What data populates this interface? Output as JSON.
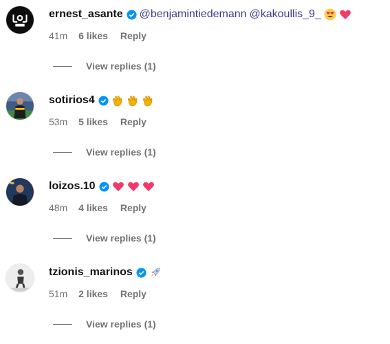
{
  "colors": {
    "verified_blue": "#0095f6",
    "muted_text": "#737373",
    "mention_text": "#3c3b8f",
    "heart": "#f03a6a"
  },
  "comments": [
    {
      "username": "ernest_asante",
      "verified": true,
      "mentions": [
        "@benjamintiedemann",
        "@kakoullis_9_"
      ],
      "emojis": [
        "smiling-face-with-heart-eyes",
        "pink-heart"
      ],
      "time": "41m",
      "likes": "6 likes",
      "reply": "Reply",
      "view_replies": "View replies (1)"
    },
    {
      "username": "sotirios4",
      "verified": true,
      "emojis": [
        "clapping-hands",
        "clapping-hands",
        "clapping-hands"
      ],
      "time": "53m",
      "likes": "5 likes",
      "reply": "Reply",
      "view_replies": "View replies (1)"
    },
    {
      "username": "loizos.10",
      "verified": true,
      "emojis": [
        "pink-heart",
        "pink-heart",
        "pink-heart"
      ],
      "time": "48m",
      "likes": "4 likes",
      "reply": "Reply",
      "view_replies": "View replies (1)"
    },
    {
      "username": "tzionis_marinos",
      "verified": true,
      "emojis": [
        "rocket"
      ],
      "time": "51m",
      "likes": "2 likes",
      "reply": "Reply",
      "view_replies": "View replies (1)"
    }
  ]
}
